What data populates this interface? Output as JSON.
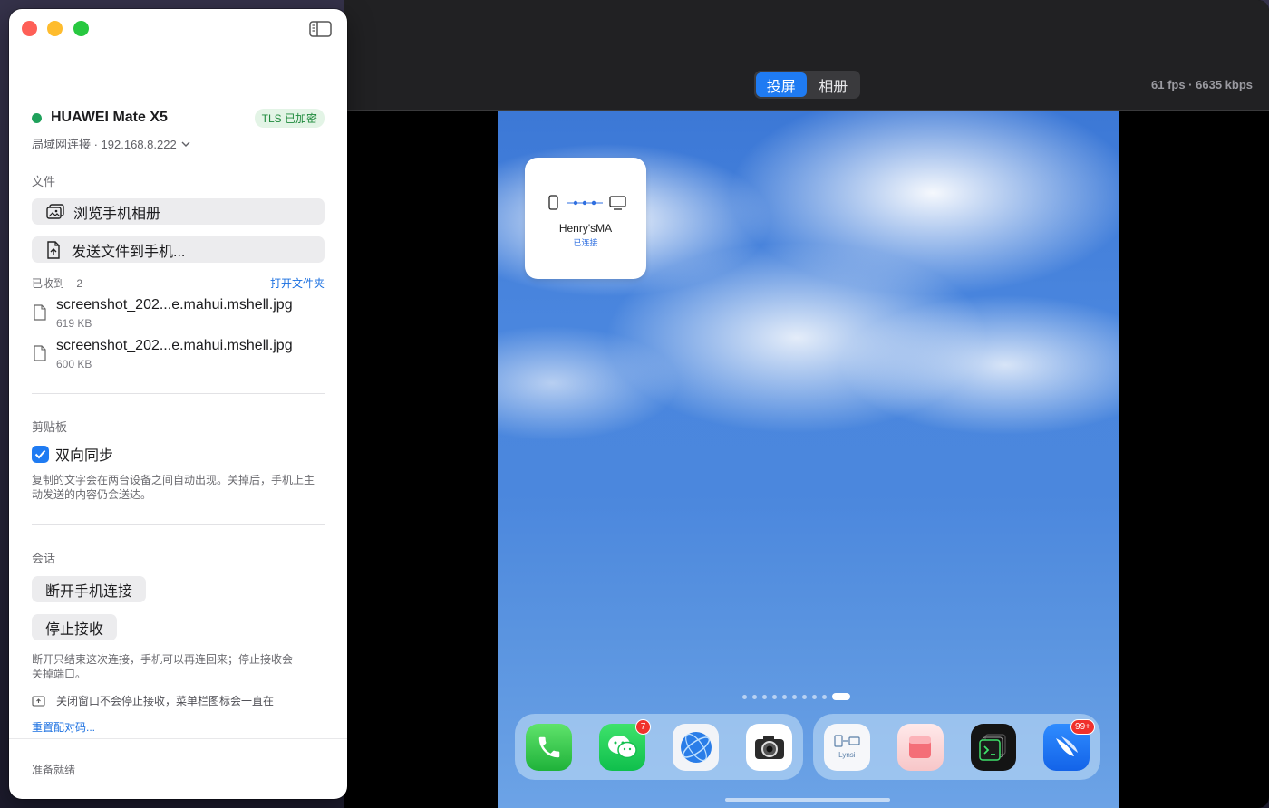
{
  "mirror": {
    "tabs": [
      {
        "label": "投屏",
        "active": true
      },
      {
        "label": "相册",
        "active": false
      }
    ],
    "stats": "61 fps · 6635 kbps",
    "accent": "#1f7bf2"
  },
  "phone": {
    "widget": {
      "name": "Henry'sMA",
      "status": "已连接"
    },
    "page_dot_count": 10,
    "active_page_index": 9,
    "dock_left": [
      {
        "name": "phone-app-icon",
        "badge": ""
      },
      {
        "name": "wechat-app-icon",
        "badge": "7"
      },
      {
        "name": "browser-app-icon",
        "badge": ""
      },
      {
        "name": "camera-app-icon",
        "badge": ""
      }
    ],
    "dock_right": [
      {
        "name": "lynsi-app-icon",
        "label": "Lynsi",
        "badge": ""
      },
      {
        "name": "red-box-app-icon",
        "badge": ""
      },
      {
        "name": "terminal-app-icon",
        "badge": ""
      },
      {
        "name": "feishu-app-icon",
        "badge": "99+"
      }
    ]
  },
  "panel": {
    "device_name": "HUAWEI Mate X5",
    "status_color": "#1fa15b",
    "tls_badge": "TLS 已加密",
    "connection": "局域网连接 · 192.168.8.222",
    "files_section": "文件",
    "browse_album": "浏览手机相册",
    "send_file": "发送文件到手机...",
    "received_label": "已收到",
    "received_count": "2",
    "open_folder": "打开文件夹",
    "files": [
      {
        "name": "screenshot_202...e.mahui.mshell.jpg",
        "size": "619 KB"
      },
      {
        "name": "screenshot_202...e.mahui.mshell.jpg",
        "size": "600 KB"
      }
    ],
    "clipboard_section": "剪贴板",
    "sync_label": "双向同步",
    "sync_checked": true,
    "sync_help": "复制的文字会在两台设备之间自动出现。关掉后，手机上主动发送的内容仍会送达。",
    "session_section": "会话",
    "disconnect": "断开手机连接",
    "stop_receive": "停止接收",
    "session_help": "断开只结束这次连接，手机可以再连回来；停止接收会关掉端口。",
    "window_note": "关闭窗口不会停止接收，菜单栏图标会一直在",
    "reset_pairing": "重置配对码...",
    "footer_status": "准备就绪"
  }
}
